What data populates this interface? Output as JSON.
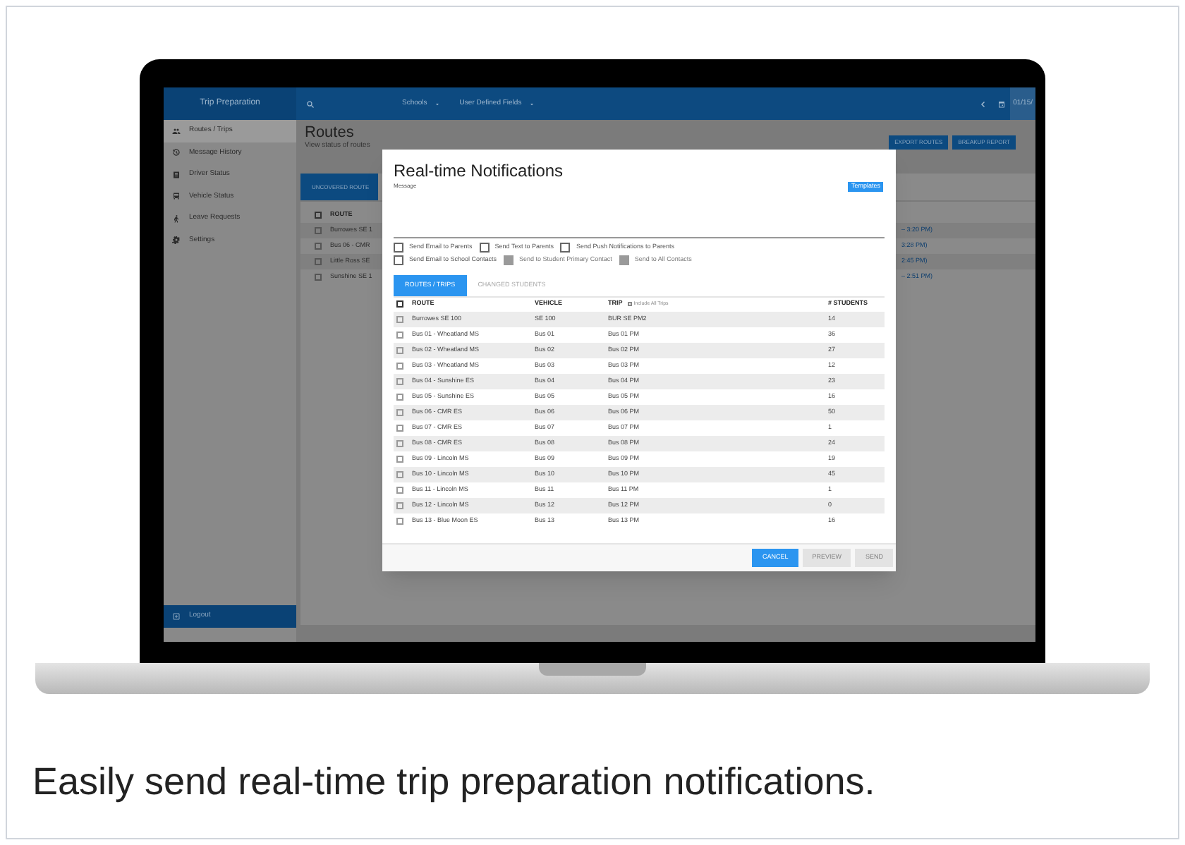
{
  "app": {
    "title": "Trip Preparation",
    "filters": [
      "Schools",
      "User Defined Fields"
    ],
    "date": "01/15/"
  },
  "sidebar": {
    "items": [
      {
        "label": "Routes / Trips",
        "selected": true
      },
      {
        "label": "Message History",
        "selected": false
      },
      {
        "label": "Driver Status",
        "selected": false
      },
      {
        "label": "Vehicle Status",
        "selected": false
      },
      {
        "label": "Leave Requests",
        "selected": false
      },
      {
        "label": "Settings",
        "selected": false
      }
    ],
    "logout": "Logout"
  },
  "page": {
    "title": "Routes",
    "subtitle": "View status of routes",
    "buttons": [
      "EXPORT ROUTES",
      "BREAKUP REPORT"
    ],
    "tab": "UNCOVERED ROUTE",
    "column": "ROUTE",
    "all_checked": false,
    "rows": [
      {
        "route": "Burrowes SE 1",
        "time": "– 3:20 PM)",
        "checked": false
      },
      {
        "route": "Bus 06 - CMR",
        "time": "3:28 PM)",
        "checked": false
      },
      {
        "route": "Little Ross SE",
        "time": "2:45 PM)",
        "checked": false
      },
      {
        "route": "Sunshine SE 1",
        "time": "– 2:51 PM)",
        "checked": false
      }
    ]
  },
  "dialog": {
    "title": "Real-time Notifications",
    "message_label": "Message",
    "templates": "Templates",
    "options": [
      [
        {
          "label": "Send Email to Parents",
          "disabled": false
        },
        {
          "label": "Send Text to Parents",
          "disabled": false
        },
        {
          "label": "Send Push Notifications to Parents",
          "disabled": false
        }
      ],
      [
        {
          "label": "Send Email to School Contacts",
          "disabled": false
        },
        {
          "label": "Send to Student Primary Contact",
          "disabled": true
        },
        {
          "label": "Send to All Contacts",
          "disabled": true
        }
      ]
    ],
    "tabs": [
      {
        "label": "ROUTES / TRIPS",
        "selected": true
      },
      {
        "label": "CHANGED STUDENTS",
        "selected": false
      }
    ],
    "columns": [
      "ROUTE",
      "VEHICLE",
      "TRIP",
      "# STUDENTS"
    ],
    "all_checked": false,
    "include_all": {
      "label": "Include All Trips",
      "checked": false
    },
    "rows": [
      {
        "cells": [
          "Burrowes SE 100",
          "SE 100",
          "BUR SE PM2",
          "14"
        ],
        "checked": false
      },
      {
        "cells": [
          "Bus 01 - Wheatland MS",
          "Bus 01",
          "Bus 01 PM",
          "36"
        ],
        "checked": false
      },
      {
        "cells": [
          "Bus 02 - Wheatland MS",
          "Bus 02",
          "Bus 02 PM",
          "27"
        ],
        "checked": false
      },
      {
        "cells": [
          "Bus 03 - Wheatland MS",
          "Bus 03",
          "Bus 03 PM",
          "12"
        ],
        "checked": false
      },
      {
        "cells": [
          "Bus 04 - Sunshine ES",
          "Bus 04",
          "Bus 04 PM",
          "23"
        ],
        "checked": false
      },
      {
        "cells": [
          "Bus 05 - Sunshine ES",
          "Bus 05",
          "Bus 05 PM",
          "16"
        ],
        "checked": false
      },
      {
        "cells": [
          "Bus 06 - CMR ES",
          "Bus 06",
          "Bus 06 PM",
          "50"
        ],
        "checked": false
      },
      {
        "cells": [
          "Bus 07 - CMR ES",
          "Bus 07",
          "Bus 07 PM",
          "1"
        ],
        "checked": false
      },
      {
        "cells": [
          "Bus 08 - CMR ES",
          "Bus 08",
          "Bus 08 PM",
          "24"
        ],
        "checked": false
      },
      {
        "cells": [
          "Bus 09 - Lincoln MS",
          "Bus 09",
          "Bus 09 PM",
          "19"
        ],
        "checked": false
      },
      {
        "cells": [
          "Bus 10 - Lincoln MS",
          "Bus 10",
          "Bus 10 PM",
          "45"
        ],
        "checked": false
      },
      {
        "cells": [
          "Bus 11 - Lincoln MS",
          "Bus 11",
          "Bus 11 PM",
          "1"
        ],
        "checked": false
      },
      {
        "cells": [
          "Bus 12 - Lincoln MS",
          "Bus 12",
          "Bus 12 PM",
          "0"
        ],
        "checked": false
      },
      {
        "cells": [
          "Bus 13 - Blue Moon ES",
          "Bus 13",
          "Bus 13 PM",
          "16"
        ],
        "checked": false
      }
    ],
    "buttons": [
      {
        "label": "CANCEL",
        "disabled": false
      },
      {
        "label": "PREVIEW",
        "disabled": true
      },
      {
        "label": "SEND",
        "disabled": true
      }
    ]
  },
  "caption": "Easily send real-time trip preparation notifications."
}
